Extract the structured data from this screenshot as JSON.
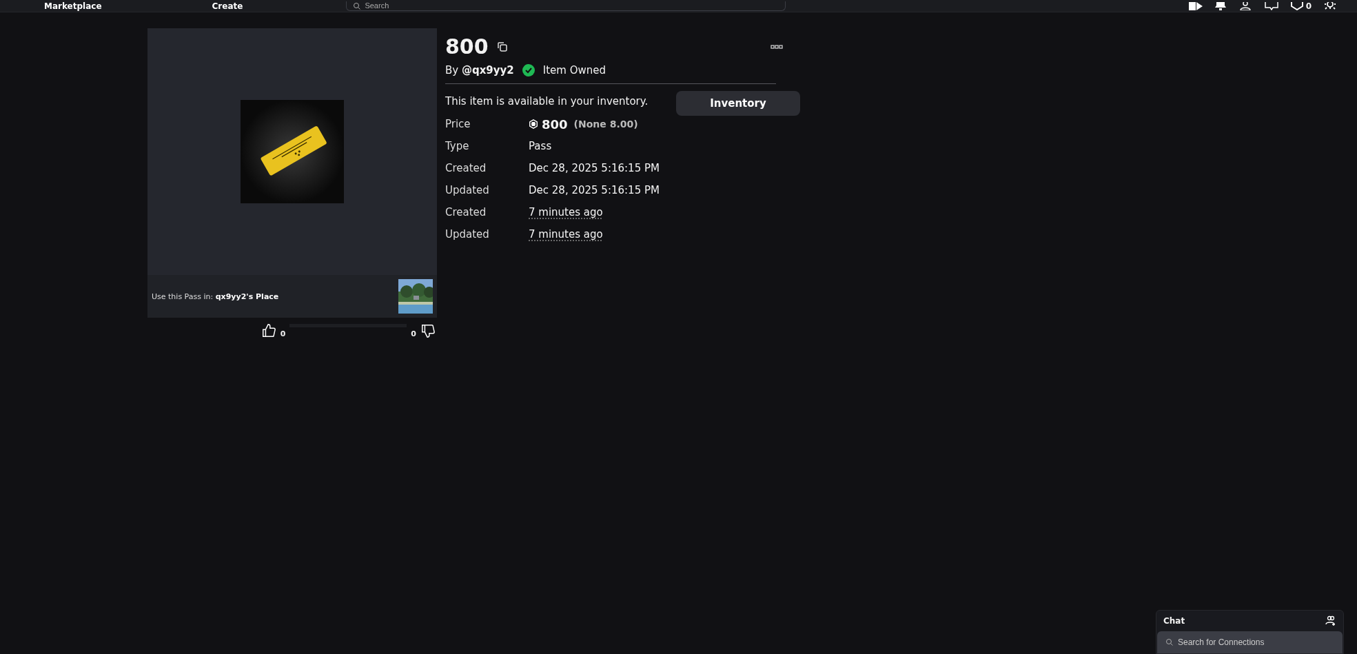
{
  "top_nav": {
    "links": [
      "Marketplace",
      "Create"
    ],
    "search": {
      "placeholder": "Search"
    },
    "robux_balance": "0"
  },
  "item": {
    "title": "800",
    "creator_prefix": "By",
    "creator": "@qx9yy2",
    "owned": true,
    "owned_label": "Item Owned",
    "availability": "This item is available in your inventory.",
    "inventory_button": "Inventory",
    "place_prefix": "Use this Pass in:",
    "place_name": "qx9yy2's Place",
    "likes": "0",
    "dislikes": "0",
    "details": [
      {
        "kind": "price",
        "label": "Price",
        "value": "800",
        "note": "(None 8.00)"
      },
      {
        "kind": "plain",
        "label": "Type",
        "value": "Pass"
      },
      {
        "kind": "plain",
        "label": "Created",
        "value": "Dec 28, 2025 5:16:15 PM"
      },
      {
        "kind": "plain",
        "label": "Updated",
        "value": "Dec 28, 2025 5:16:15 PM"
      },
      {
        "kind": "relative",
        "label": "Created",
        "value": "7 minutes ago"
      },
      {
        "kind": "relative",
        "label": "Updated",
        "value": "7 minutes ago"
      }
    ]
  },
  "chat": {
    "title": "Chat",
    "search": {
      "placeholder": "Search for Connections"
    }
  }
}
